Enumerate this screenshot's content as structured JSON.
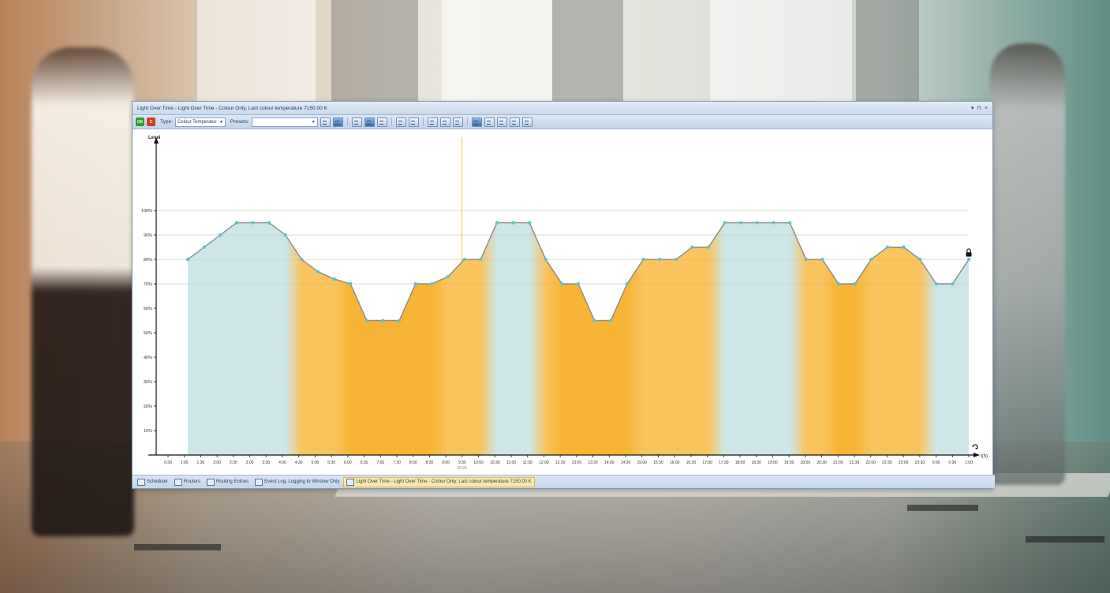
{
  "window": {
    "title": "Light Over Time - Light Over Time - Colour Only, Last colour temperature 7150.00 K",
    "controls": [
      "▾",
      "⊓",
      "×"
    ]
  },
  "toolbar": {
    "ok_label": "OK",
    "cancel_label": "C",
    "type_label": "Type:",
    "type_value": "Colour Temperatur",
    "presets_label": "Presets:",
    "presets_value": ""
  },
  "tabs": [
    {
      "label": "Scheduler"
    },
    {
      "label": "Routers"
    },
    {
      "label": "Routing Entries"
    },
    {
      "label": "Event Log, Logging to Window Only"
    },
    {
      "label": "Light Over Time - Light Over Time - Colour Only, Last colour temperature 7150.00 K"
    }
  ],
  "icons": {
    "lock": "lock-icon",
    "refresh": "refresh-icon"
  },
  "colors": {
    "warm": "#f8b02a",
    "cool": "#bcdde0",
    "line": "#8a8a8a",
    "point": "#5cc5cc",
    "cursor": "#f5c542"
  },
  "chart_data": {
    "type": "area",
    "title": "",
    "ylabel": "Level",
    "xlabel": "t(h)",
    "ylim": [
      0,
      100
    ],
    "yticks": [
      "10%",
      "20%",
      "30%",
      "40%",
      "50%",
      "60%",
      "70%",
      "80%",
      "90%",
      "100%"
    ],
    "grid": "horizontal",
    "cursor_label": "09:26",
    "xticks": [
      "0:30",
      "1:00",
      "1:30",
      "2:00",
      "2:30",
      "3:00",
      "3:30",
      "4:00",
      "4:30",
      "5:00",
      "5:30",
      "6:00",
      "6:30",
      "7:00",
      "7:30",
      "8:00",
      "8:30",
      "9:00",
      "9:30",
      "10:00",
      "10:30",
      "11:00",
      "11:30",
      "12:00",
      "12:30",
      "13:00",
      "13:30",
      "14:00",
      "14:30",
      "15:00",
      "15:30",
      "16:00",
      "16:30",
      "17:00",
      "17:30",
      "18:00",
      "18:30",
      "19:00",
      "19:30",
      "20:00",
      "20:30",
      "21:00",
      "21:30",
      "22:00",
      "22:30",
      "23:00",
      "23:30",
      "0:00",
      "0:30",
      "1:00"
    ],
    "series": [
      {
        "values": [
          80,
          85,
          90,
          95,
          95,
          95,
          90,
          80,
          75,
          72,
          70,
          55,
          55,
          55,
          70,
          70,
          73,
          80,
          80,
          95,
          95,
          95,
          80,
          70,
          70,
          55,
          55,
          70,
          80,
          80,
          80,
          85,
          85,
          95,
          95,
          95,
          95,
          95,
          80,
          80,
          70,
          70,
          80,
          85,
          85,
          80,
          70,
          70,
          80
        ]
      }
    ],
    "colour_bands": [
      "cool",
      "cool",
      "cool",
      "cool",
      "cool",
      "cool",
      "cool",
      "warm",
      "warm",
      "warm",
      "warm",
      "warm",
      "warm",
      "warm",
      "warm",
      "warm",
      "warm",
      "warm",
      "warm",
      "cool",
      "cool",
      "cool",
      "warm",
      "warm",
      "warm",
      "warm",
      "warm",
      "warm",
      "warm",
      "warm",
      "warm",
      "warm",
      "warm",
      "cool",
      "cool",
      "cool",
      "cool",
      "cool",
      "warm",
      "warm",
      "warm",
      "warm",
      "warm",
      "warm",
      "warm",
      "warm",
      "cool",
      "cool",
      "cool"
    ]
  }
}
